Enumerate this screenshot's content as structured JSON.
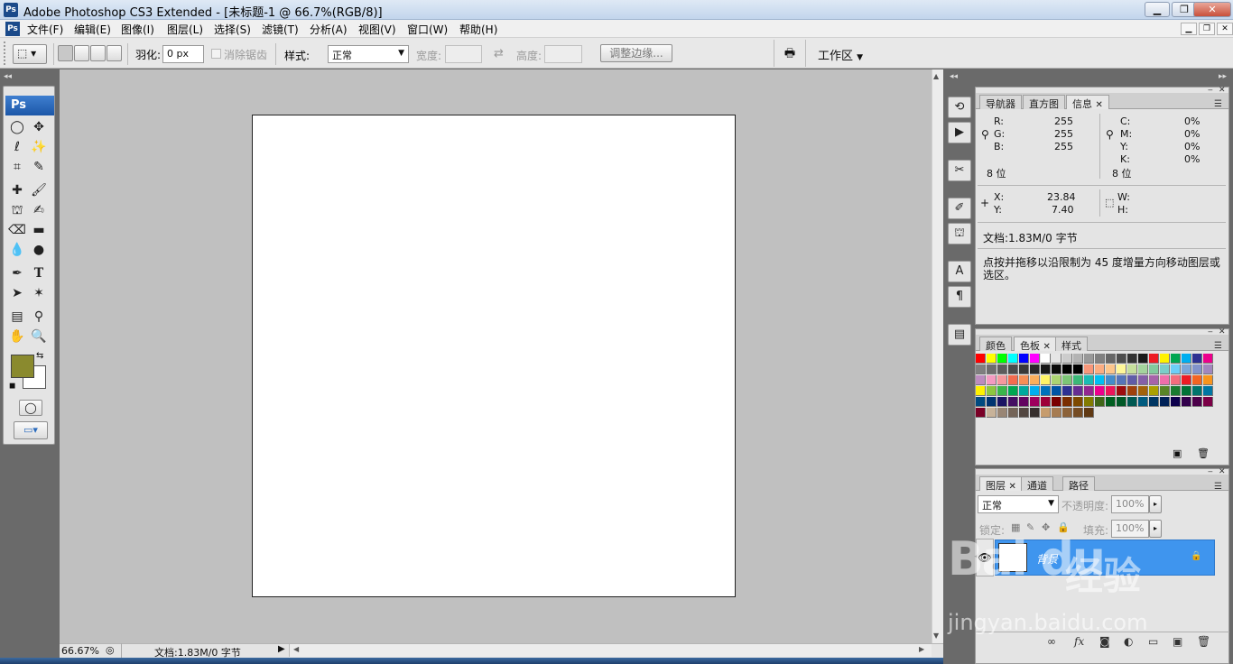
{
  "window": {
    "title": "Adobe Photoshop CS3 Extended - [未标题-1 @ 66.7%(RGB/8)]",
    "logo": "Ps",
    "buttons": [
      "minimize",
      "maximize",
      "close"
    ]
  },
  "menu": {
    "items": [
      "文件(F)",
      "编辑(E)",
      "图像(I)",
      "图层(L)",
      "选择(S)",
      "滤镜(T)",
      "分析(A)",
      "视图(V)",
      "窗口(W)",
      "帮助(H)"
    ]
  },
  "options": {
    "feather_label": "羽化:",
    "feather_value": "0 px",
    "antialias_label": "消除锯齿",
    "style_label": "样式:",
    "style_value": "正常",
    "width_label": "宽度:",
    "height_label": "高度:",
    "refine_edge": "调整边缘...",
    "workspace": "工作区"
  },
  "toolbox": {
    "logo": "Ps",
    "foreground_color": "#8a8a2e",
    "background_color": "#ffffff"
  },
  "status": {
    "zoom": "66.67%",
    "docsize": "文档:1.83M/0 字节"
  },
  "info_panel": {
    "tabs": [
      "导航器",
      "直方图",
      "信息"
    ],
    "rgb": {
      "r_label": "R:",
      "g_label": "G:",
      "b_label": "B:",
      "r": "255",
      "g": "255",
      "b": "255",
      "bits": "8 位"
    },
    "cmyk": {
      "c_label": "C:",
      "m_label": "M:",
      "y_label": "Y:",
      "k_label": "K:",
      "c": "0%",
      "m": "0%",
      "y": "0%",
      "k": "0%",
      "bits": "8 位"
    },
    "xy": {
      "x_label": "X:",
      "y_label": "Y:",
      "x": "23.84",
      "y": "7.40",
      "w_label": "W:",
      "h_label": "H:"
    },
    "doc": "文档:1.83M/0 字节",
    "hint": "点按并拖移以沿限制为 45 度增量方向移动图层或选区。"
  },
  "swatches_panel": {
    "tabs": [
      "颜色",
      "色板",
      "样式"
    ]
  },
  "layers_panel": {
    "tabs": [
      "图层",
      "通道",
      "路径"
    ],
    "blend_mode": "正常",
    "opacity_label": "不透明度:",
    "opacity": "100%",
    "lock_label": "锁定:",
    "fill_label": "填充:",
    "fill": "100%",
    "layer_name": "背景"
  },
  "watermark": {
    "brand": "Bai du",
    "brand_cn": "经验",
    "url": "jingyan.baidu.com"
  }
}
